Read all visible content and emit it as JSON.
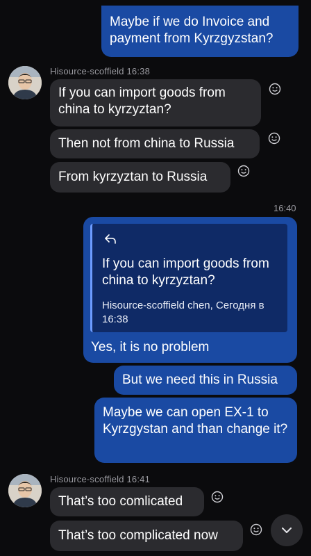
{
  "messages_top": {
    "out_0": "Maybe if we do Invoice and payment from Kyrzgyzstan?"
  },
  "group_1": {
    "sender": "Hisource-scoffield 16:38",
    "msg_1": "If you can import goods from china to kyrzyztan?",
    "msg_2": "Then not from china to Russia",
    "msg_3": "From kyrzyztan to Russia"
  },
  "time_separator": "16:40",
  "outgoing": {
    "reply_quote": "If you can import goods from china to kyrzyztan?",
    "reply_meta": "Hisource-scoffield chen, Сегодня в 16:38",
    "reply_answer": "Yes, it is no problem",
    "msg_2": "But we need this in Russia",
    "msg_3": "Maybe we can open EX-1 to Kyrzgystan and than change it?"
  },
  "group_2": {
    "sender": "Hisource-scoffield 16:41",
    "msg_1": "That’s too comlicated",
    "msg_2": "That’s too complicated now"
  },
  "icons": {
    "reaction": "smiley-icon",
    "reply": "reply-arrow-icon",
    "scroll": "chevron-down-icon",
    "avatar": "avatar"
  },
  "colors": {
    "background": "#0b0b0d",
    "incoming_bubble": "#2b2b2f",
    "outgoing_bubble": "#1a4aa3",
    "reply_box": "#0f2a66"
  }
}
